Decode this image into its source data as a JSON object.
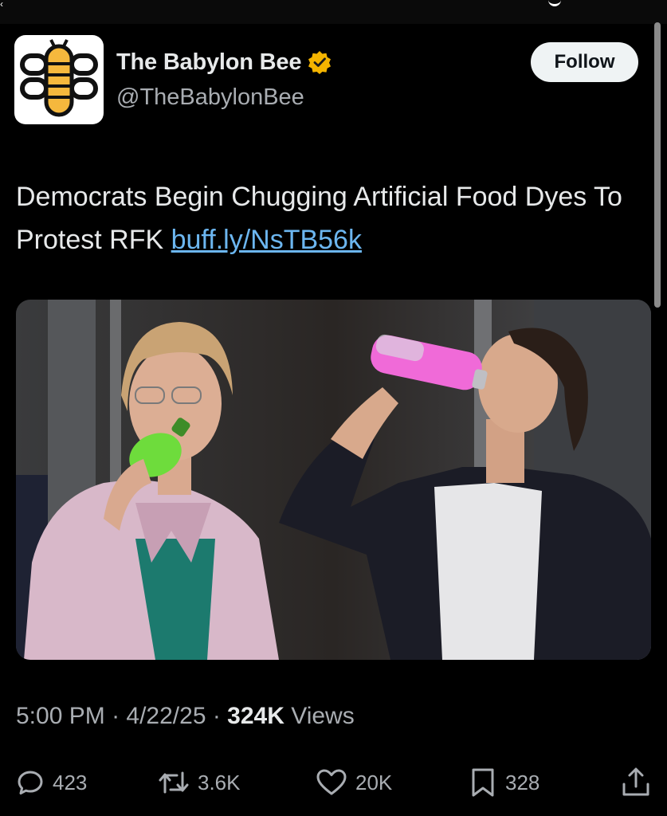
{
  "account": {
    "display_name": "The Babylon Bee",
    "handle": "@TheBabylonBee",
    "verified_icon": "verified-gold-badge-icon",
    "follow_label": "Follow"
  },
  "tweet": {
    "text": "Democrats Begin Chugging Artificial Food Dyes To Protest RFK ",
    "link_text": "buff.ly/NsTB56k"
  },
  "meta": {
    "time": "5:00 PM",
    "separator": " · ",
    "date": "4/22/25",
    "views_count": "324K",
    "views_label": " Views"
  },
  "actions": {
    "replies": {
      "icon": "reply-icon",
      "count": "423"
    },
    "reposts": {
      "icon": "repost-icon",
      "count": "3.6K"
    },
    "likes": {
      "icon": "heart-icon",
      "count": "20K"
    },
    "bookmarks": {
      "icon": "bookmark-icon",
      "count": "328"
    },
    "share": {
      "icon": "share-icon"
    }
  },
  "colors": {
    "background": "#000000",
    "text": "#e7e9ea",
    "secondary": "#a9adb2",
    "link": "#6cb6f0",
    "verified": "#f4b400",
    "bee_yellow": "#f5b83d"
  }
}
